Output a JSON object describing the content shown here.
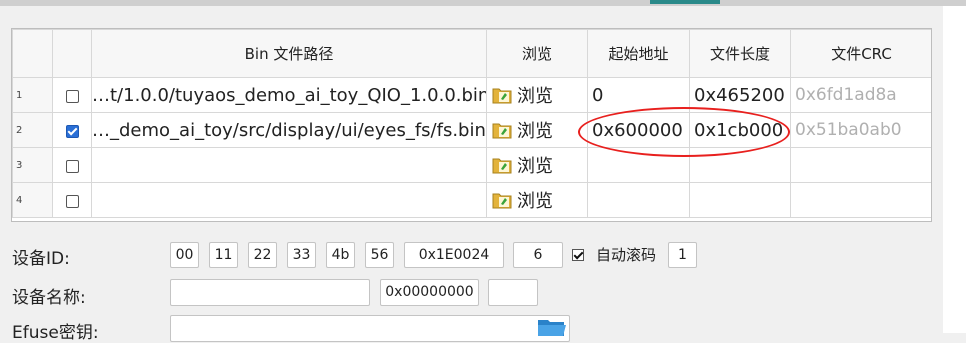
{
  "table": {
    "headers": [
      "",
      "",
      "Bin 文件路径",
      "浏览",
      "起始地址",
      "文件长度",
      "文件CRC"
    ],
    "rows": [
      {
        "num": "1",
        "checked": false,
        "path": "…t/1.0.0/tuyaos_demo_ai_toy_QIO_1.0.0.bin",
        "browse": "浏览",
        "start": "0",
        "length": "0x465200",
        "crc": "0x6fd1ad8a"
      },
      {
        "num": "2",
        "checked": true,
        "path": "…_demo_ai_toy/src/display/ui/eyes_fs/fs.bin",
        "browse": "浏览",
        "start": "0x600000",
        "length": "0x1cb000",
        "crc": "0x51ba0ab0"
      },
      {
        "num": "3",
        "checked": false,
        "path": "",
        "browse": "浏览",
        "start": "",
        "length": "",
        "crc": ""
      },
      {
        "num": "4",
        "checked": false,
        "path": "",
        "browse": "浏览",
        "start": "",
        "length": "",
        "crc": ""
      }
    ]
  },
  "device": {
    "id_label": "设备ID:",
    "id_bytes": [
      "00",
      "11",
      "22",
      "33",
      "4b",
      "56"
    ],
    "id_value": "0x1E0024",
    "id_count": "6",
    "auto_scroll_label": "自动滚码",
    "auto_scroll_step": "1",
    "name_label": "设备名称:",
    "name_value": "",
    "name_hex": "0x00000000",
    "name_extra": "",
    "efuse_label": "Efuse密钥:"
  },
  "icons": {
    "browse": "folder-icon",
    "efuse_browse": "folder-open-icon",
    "checkbox": "checkbox-icon"
  },
  "colors": {
    "highlight": "#e8201e",
    "checkbox_checked": "#2a6fd6",
    "crc_text": "#b0b0b0"
  }
}
